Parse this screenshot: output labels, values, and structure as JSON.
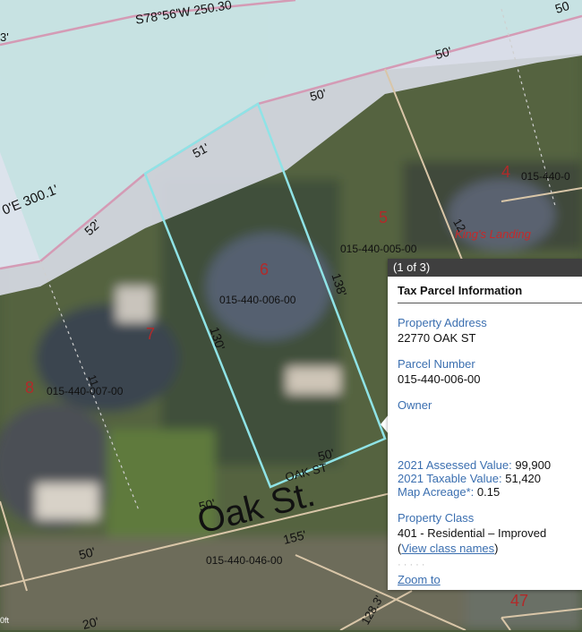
{
  "map": {
    "bearing_top": "S78°56'W 250.30",
    "bearing_left": "0'E 300.1'",
    "street_name_large": "Oak St.",
    "street_name_small": "OAK ST",
    "place_label": "King's Landing",
    "lots": [
      {
        "number": "4",
        "parcel_id": "015-440-0"
      },
      {
        "number": "5",
        "parcel_id": "015-440-005-00"
      },
      {
        "number": "6",
        "parcel_id": "015-440-006-00"
      },
      {
        "number": "7",
        "parcel_id": ""
      },
      {
        "number": "8",
        "parcel_id": "015-440-007-00"
      },
      {
        "number": "47",
        "parcel_id": ""
      }
    ],
    "parcel_bottom": "015-440-046-00",
    "dims": {
      "d50_top": "50'",
      "d50_a": "50'",
      "d50_b": "50'",
      "d51": "51'",
      "d52": "52'",
      "d138": "138'",
      "d130": "130'",
      "d11": "11",
      "d50_oak": "50'",
      "d50_left": "50'",
      "d50_bl": "50'",
      "d155": "155'",
      "d128": "128.3'",
      "d20": "20'",
      "d12": "12",
      "d3": "3'",
      "d50_tr": "50"
    },
    "scale_label": "0ft"
  },
  "popup": {
    "counter": "(1 of 3)",
    "title": "Tax Parcel Information",
    "address_label": "Property Address",
    "address_value": "22770 OAK ST",
    "parcel_label": "Parcel Number",
    "parcel_value": "015-440-006-00",
    "owner_label": "Owner",
    "assessed_label": "2021 Assessed Value:",
    "assessed_value": "99,900",
    "taxable_label": "2021 Taxable Value:",
    "taxable_value": "51,420",
    "acreage_label": "Map Acreage*:",
    "acreage_value": "0.15",
    "class_label": "Property Class",
    "class_value": "401 - Residential – Improved",
    "class_link_open": "(",
    "class_link": "View class names",
    "class_link_close": ")",
    "zoom_link": "Zoom to"
  }
}
